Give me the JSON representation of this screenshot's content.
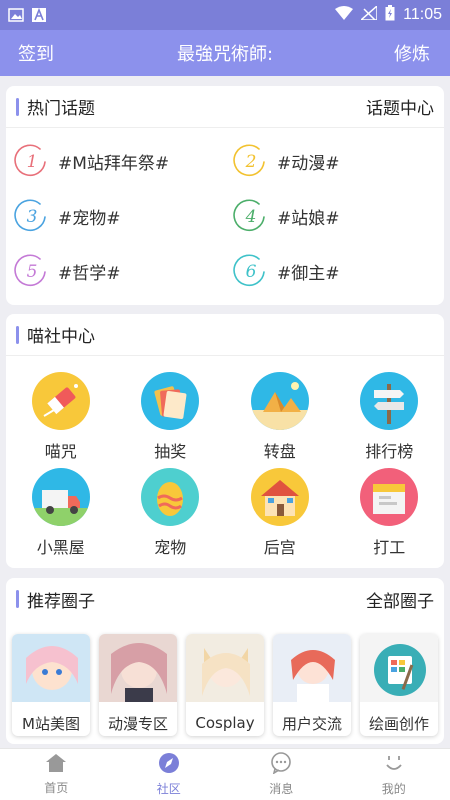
{
  "status_bar": {
    "time": "11:05"
  },
  "header": {
    "left": "签到",
    "center": "最強咒術師:",
    "right": "修炼"
  },
  "hot_topics": {
    "title": "热门话题",
    "more": "话题中心",
    "items": [
      {
        "num": "1",
        "label": "#M站拜年祭#",
        "color": "#e8707a"
      },
      {
        "num": "2",
        "label": "#动漫#",
        "color": "#f2c230"
      },
      {
        "num": "3",
        "label": "#宠物#",
        "color": "#4aa3e0"
      },
      {
        "num": "4",
        "label": "#站娘#",
        "color": "#4cae6a"
      },
      {
        "num": "5",
        "label": "#哲学#",
        "color": "#c47ad6"
      },
      {
        "num": "6",
        "label": "#御主#",
        "color": "#3fc2c9"
      }
    ]
  },
  "meow_center": {
    "title": "喵社中心",
    "items": [
      {
        "label": "喵咒",
        "icon": "eraser-icon"
      },
      {
        "label": "抽奖",
        "icon": "lottery-cards-icon"
      },
      {
        "label": "转盘",
        "icon": "pyramid-icon"
      },
      {
        "label": "排行榜",
        "icon": "signpost-icon"
      },
      {
        "label": "小黑屋",
        "icon": "truck-icon"
      },
      {
        "label": "宠物",
        "icon": "egg-icon"
      },
      {
        "label": "后宫",
        "icon": "house-icon"
      },
      {
        "label": "打工",
        "icon": "box-icon"
      }
    ]
  },
  "circles": {
    "title": "推荐圈子",
    "more": "全部圈子",
    "items": [
      {
        "label": "M站美图"
      },
      {
        "label": "动漫专区"
      },
      {
        "label": "Cosplay"
      },
      {
        "label": "用户交流"
      },
      {
        "label": "绘画创作"
      }
    ]
  },
  "tabbar": {
    "items": [
      {
        "label": "首页",
        "icon": "home-icon"
      },
      {
        "label": "社区",
        "icon": "compass-icon",
        "active": true
      },
      {
        "label": "消息",
        "icon": "message-icon"
      },
      {
        "label": "我的",
        "icon": "smile-icon"
      }
    ]
  },
  "colors": {
    "accent": "#8c91ec",
    "status": "#7b7fd8"
  }
}
